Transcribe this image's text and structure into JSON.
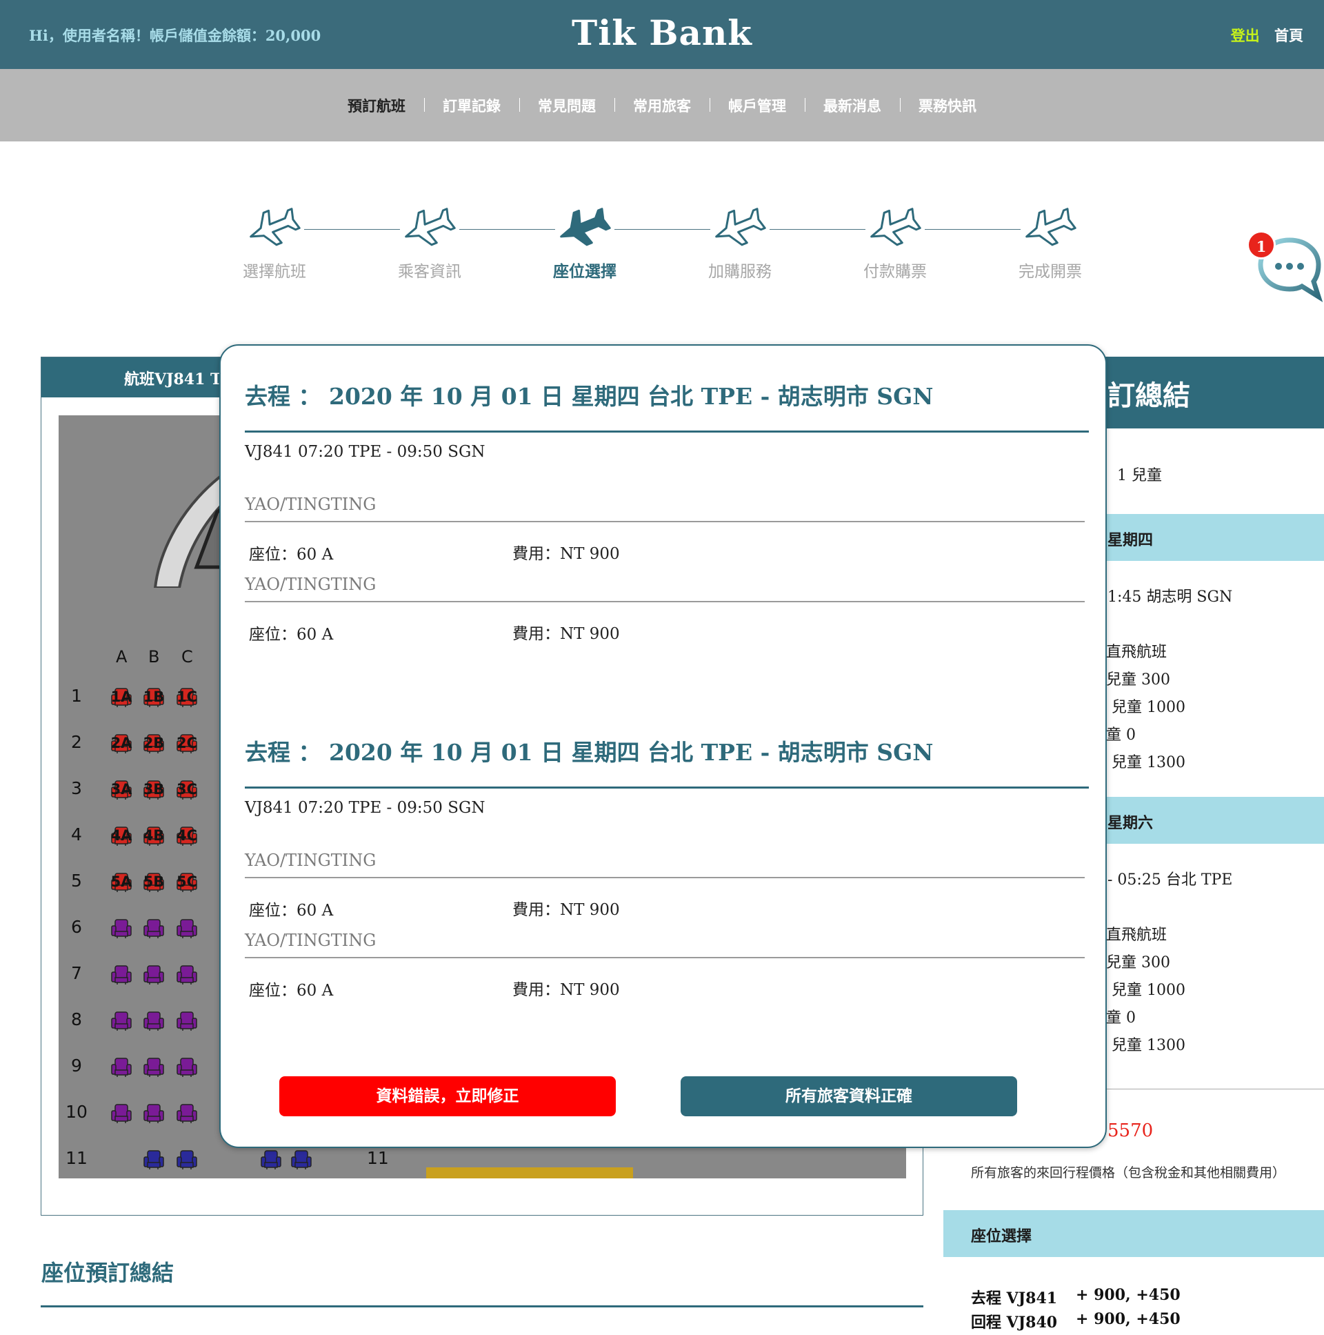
{
  "header": {
    "greeting": "Hi，使用者名稱！帳戶儲值金餘額：20,000",
    "logo": "Tik Bank",
    "logout": "登出",
    "home": "首頁"
  },
  "nav": [
    "預訂航班",
    "訂單記錄",
    "常見問題",
    "常用旅客",
    "帳戶管理",
    "最新消息",
    "票務快訊"
  ],
  "steps": [
    {
      "label": "選擇航班",
      "active": false
    },
    {
      "label": "乘客資訊",
      "active": false
    },
    {
      "label": "座位選擇",
      "active": true
    },
    {
      "label": "加購服務",
      "active": false
    },
    {
      "label": "付款購票",
      "active": false
    },
    {
      "label": "完成開票",
      "active": false
    }
  ],
  "chat": {
    "badge": "1"
  },
  "seat_panel": {
    "header": "航班VJ841 TI",
    "columns": [
      "A",
      "B",
      "C"
    ],
    "rows": [
      "1",
      "2",
      "3",
      "4",
      "5",
      "6",
      "7",
      "8",
      "9",
      "10",
      "11"
    ],
    "occupied_rows": [
      [
        "1A",
        "1B",
        "1C"
      ],
      [
        "2A",
        "2B",
        "2C"
      ],
      [
        "3A",
        "3B",
        "3C"
      ],
      [
        "4A",
        "4B",
        "4C"
      ],
      [
        "5A",
        "5B",
        "5C"
      ]
    ],
    "right_row_label": "11",
    "overlay_char": "位",
    "colors": {
      "occupied": "#d4261f",
      "available": "#7a1b96",
      "row11": "#2a2a9a",
      "exit": "#c9a01e"
    }
  },
  "seat_summary_title": "座位預訂總結",
  "summary": {
    "title": "訂總結",
    "passengers": "1 兒童",
    "outbound_band": "星期四",
    "outbound_route": "1:45 胡志明 SGN",
    "outbound_lines": [
      "直飛航班",
      "兒童 300",
      "兒童 1000",
      "童 0",
      "兒童 1300"
    ],
    "return_band": "星期六",
    "return_route": "- 05:25 台北 TPE",
    "return_lines": [
      "直飛航班",
      "兒童 300",
      "兒童 1000",
      "童 0",
      "兒童 1300"
    ],
    "total": "5570",
    "note": "所有旅客的來回行程價格（包含稅金和其他相關費用）",
    "seat_band": "座位選擇",
    "seat_lines": [
      {
        "flight": "去程 VJ841",
        "amount": "+ 900,   +450"
      },
      {
        "flight": "回程 VJ840",
        "amount": "+ 900,   +450"
      }
    ]
  },
  "modal": {
    "trips": [
      {
        "title": "去程 ： 2020 年 10 月 01 日 星期四  台北 TPE - 胡志明市 SGN",
        "flight": "VJ841 07:20  TPE - 09:50 SGN",
        "passengers": [
          {
            "name": "YAO/TINGTING",
            "seat": "座位：60 A",
            "fee": "費用：NT 900"
          },
          {
            "name": "YAO/TINGTING",
            "seat": "座位：60 A",
            "fee": "費用：NT 900"
          }
        ]
      },
      {
        "title": "去程 ： 2020 年 10 月 01 日 星期四  台北 TPE - 胡志明市 SGN",
        "flight": "VJ841 07:20  TPE - 09:50 SGN",
        "passengers": [
          {
            "name": "YAO/TINGTING",
            "seat": "座位：60 A",
            "fee": "費用：NT 900"
          },
          {
            "name": "YAO/TINGTING",
            "seat": "座位：60 A",
            "fee": "費用：NT 900"
          }
        ]
      }
    ],
    "btn_fix": "資料錯誤，立即修正",
    "btn_ok": "所有旅客資料正確"
  }
}
